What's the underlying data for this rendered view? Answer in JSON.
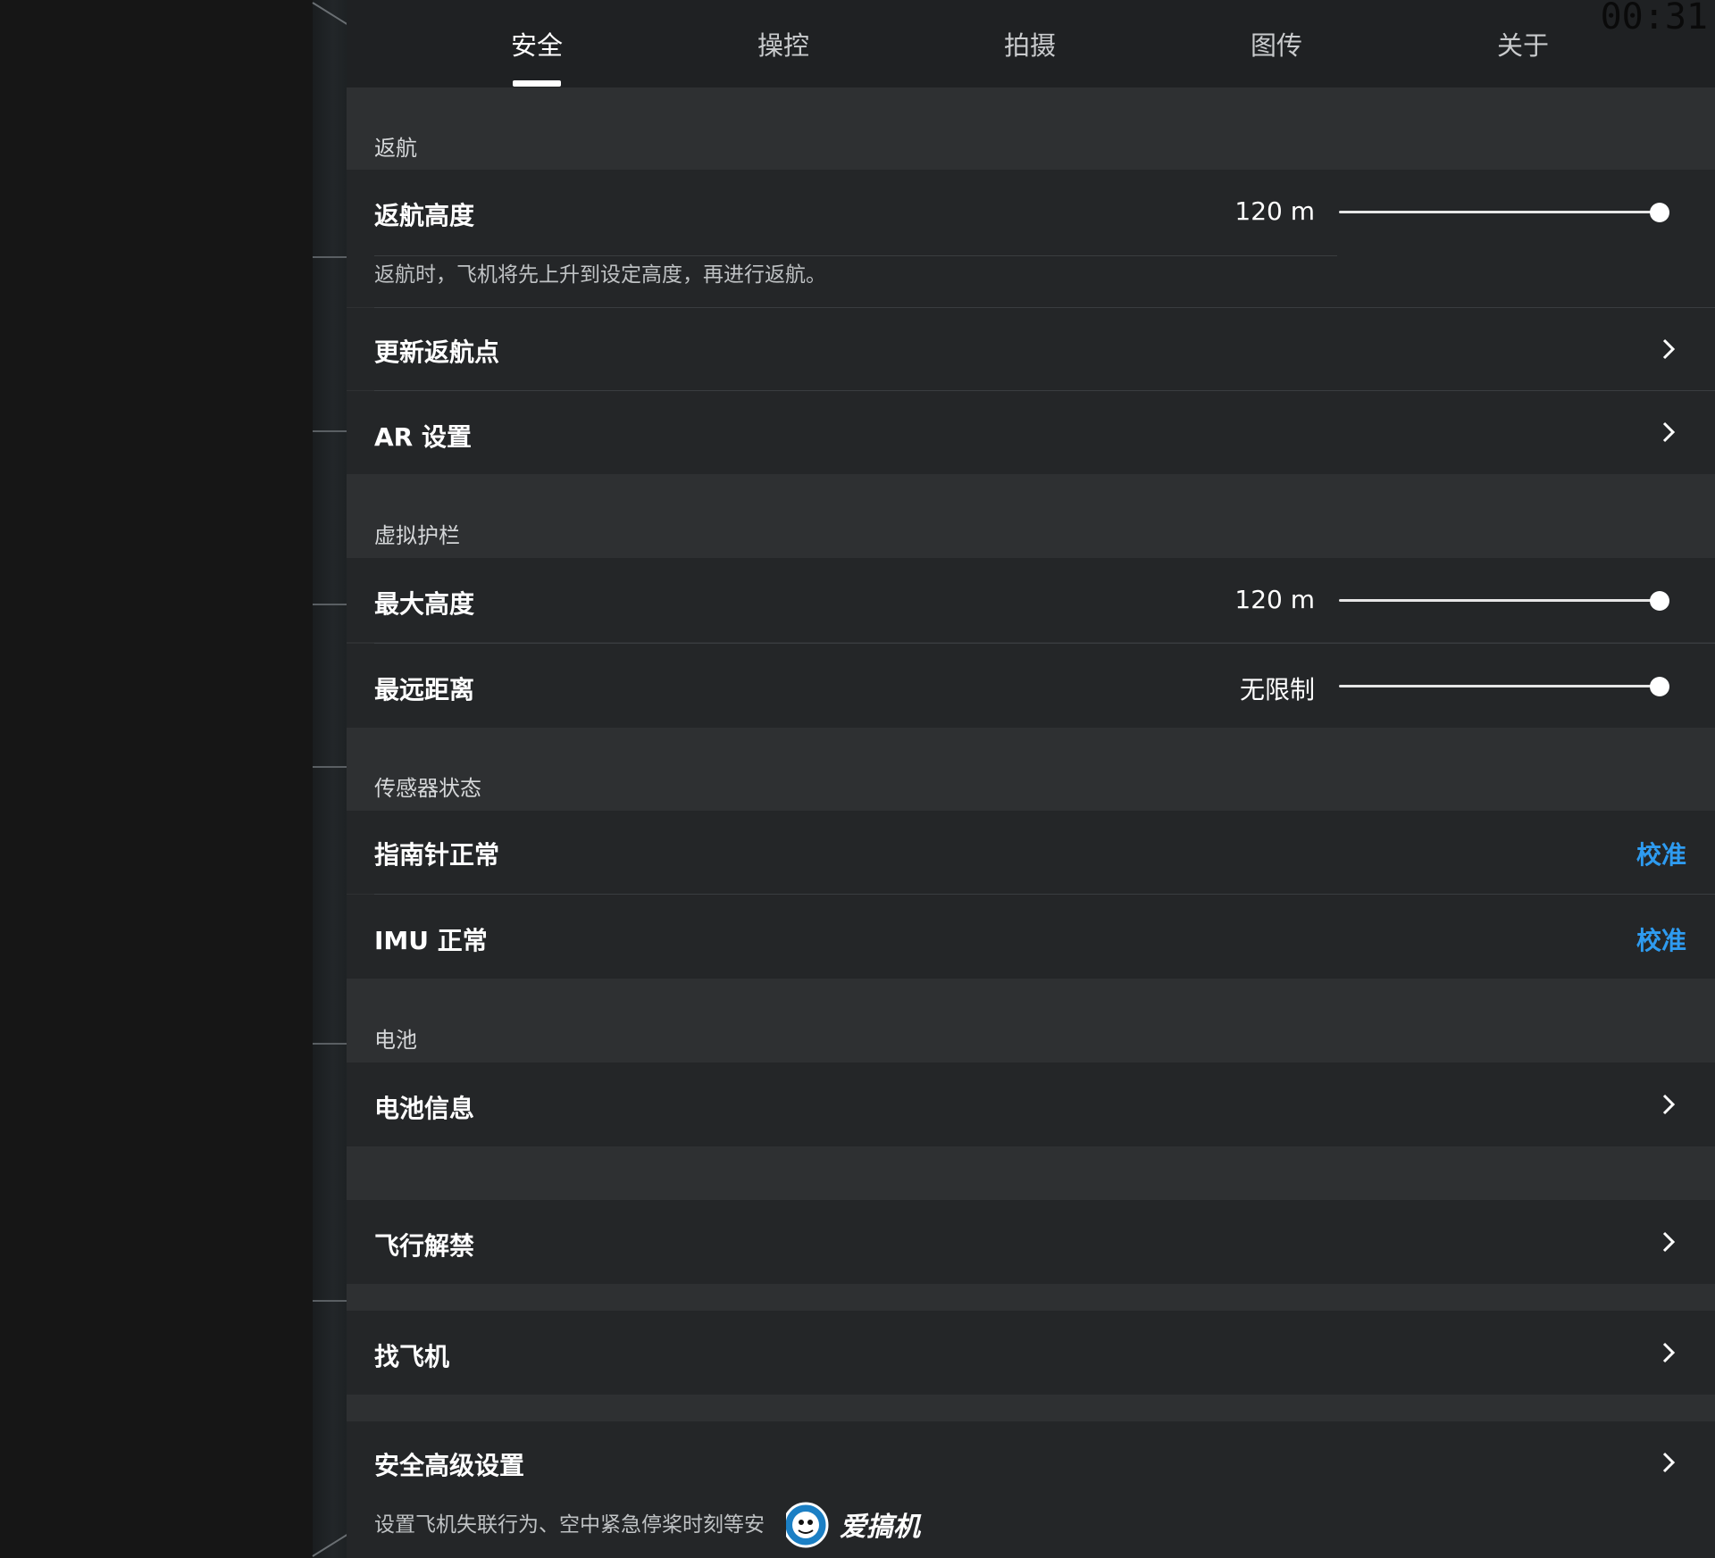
{
  "status": {
    "clock": "00:31"
  },
  "tabs": [
    {
      "label": "安全"
    },
    {
      "label": "操控"
    },
    {
      "label": "拍摄"
    },
    {
      "label": "图传"
    },
    {
      "label": "关于"
    }
  ],
  "sections": {
    "rth": {
      "title": "返航",
      "altitude": {
        "label": "返航高度",
        "value": "120 m",
        "slider_level": 1.0,
        "description": "返航时，飞机将先上升到设定高度，再进行返航。"
      },
      "update_home": {
        "label": "更新返航点"
      },
      "ar": {
        "label": "AR 设置"
      }
    },
    "fence": {
      "title": "虚拟护栏",
      "max_height": {
        "label": "最大高度",
        "value": "120 m",
        "slider_level": 1.0
      },
      "max_distance": {
        "label": "最远距离",
        "value": "无限制",
        "slider_level": 1.0
      }
    },
    "sensors": {
      "title": "传感器状态",
      "compass": {
        "label": "指南针正常",
        "action": "校准"
      },
      "imu": {
        "label": "IMU 正常",
        "action": "校准"
      }
    },
    "battery": {
      "title": "电池",
      "info": {
        "label": "电池信息"
      }
    },
    "unlock": {
      "label": "飞行解禁"
    },
    "find": {
      "label": "找飞机"
    },
    "advanced": {
      "label": "安全高级设置",
      "description": "设置飞机失联行为、空中紧急停桨时刻等安"
    }
  },
  "watermark": {
    "text": "爱搞机"
  },
  "colors": {
    "accent": "#2e9bf0",
    "panel": "#2e3032",
    "row": "#242628",
    "tabbar": "#1f2123"
  },
  "icons": {
    "chevron": "chevron-right-icon"
  }
}
